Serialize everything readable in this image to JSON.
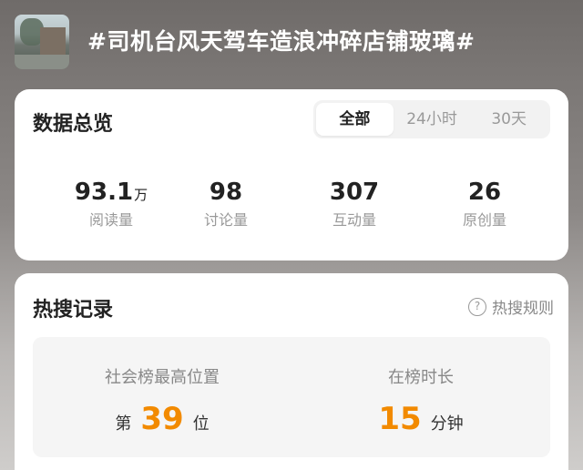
{
  "header": {
    "topic": "#司机台风天驾车造浪冲碎店铺玻璃#"
  },
  "overview": {
    "title": "数据总览",
    "tabs": [
      {
        "label": "全部",
        "active": true
      },
      {
        "label": "24小时",
        "active": false
      },
      {
        "label": "30天",
        "active": false
      }
    ],
    "stats": [
      {
        "value": "93.1",
        "unit": "万",
        "label": "阅读量"
      },
      {
        "value": "98",
        "unit": "",
        "label": "讨论量"
      },
      {
        "value": "307",
        "unit": "",
        "label": "互动量"
      },
      {
        "value": "26",
        "unit": "",
        "label": "原创量"
      }
    ]
  },
  "hot_search": {
    "title": "热搜记录",
    "rules_label": "热搜规则",
    "rules_icon": "question-circle-icon",
    "highest_rank": {
      "label": "社会榜最高位置",
      "prefix": "第",
      "value": "39",
      "suffix": "位"
    },
    "duration": {
      "label": "在榜时长",
      "value": "15",
      "suffix": "分钟"
    },
    "accent_color": "#f28a00"
  }
}
